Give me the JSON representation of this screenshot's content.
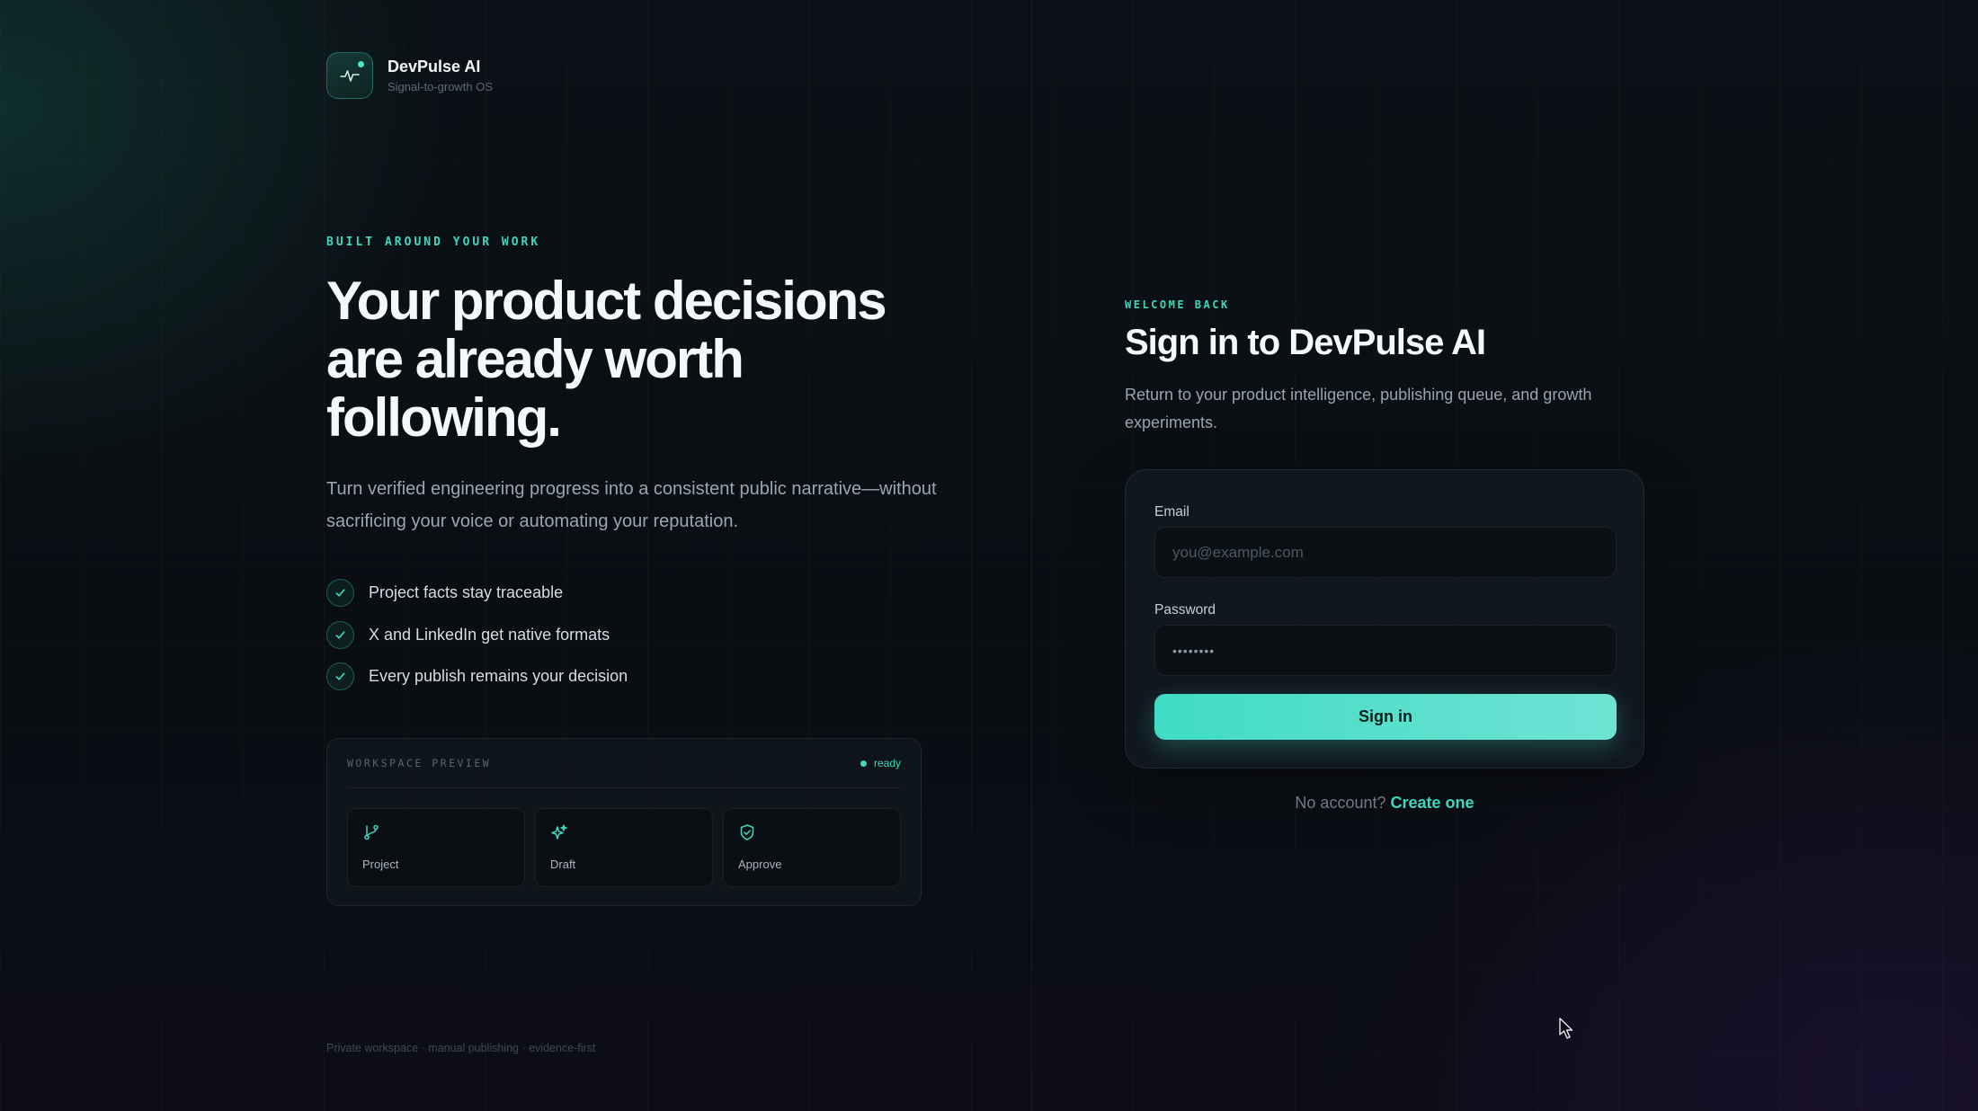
{
  "brand": {
    "name": "DevPulse AI",
    "tagline": "Signal-to-growth OS",
    "logo_icon": "pulse-icon"
  },
  "hero": {
    "eyebrow": "BUILT AROUND YOUR WORK",
    "headline_lines": [
      "Your product decisions",
      "are already worth",
      "following."
    ],
    "lede": "Turn verified engineering progress into a consistent public narrative—without sacrificing your voice or automating your reputation.",
    "checks": [
      "Project facts stay traceable",
      "X and LinkedIn get native formats",
      "Every publish remains your decision"
    ]
  },
  "preview": {
    "title": "WORKSPACE PREVIEW",
    "status": "ready",
    "tiles": [
      {
        "label": "Project",
        "icon": "branch-icon"
      },
      {
        "label": "Draft",
        "icon": "sparkle-icon"
      },
      {
        "label": "Approve",
        "icon": "shield-check-icon"
      }
    ]
  },
  "footnote": "Private workspace · manual publishing · evidence-first",
  "signin": {
    "eyebrow": "WELCOME BACK",
    "title": "Sign in to DevPulse AI",
    "subtitle": "Return to your product intelligence, publishing queue, and growth experiments.",
    "email_label": "Email",
    "email_placeholder": "you@example.com",
    "password_label": "Password",
    "password_value": "••••••••",
    "button_label": "Sign in",
    "no_account_text": "No account?",
    "create_link": "Create one"
  },
  "colors": {
    "accent": "#40d6bd",
    "background": "#0a0e13"
  }
}
